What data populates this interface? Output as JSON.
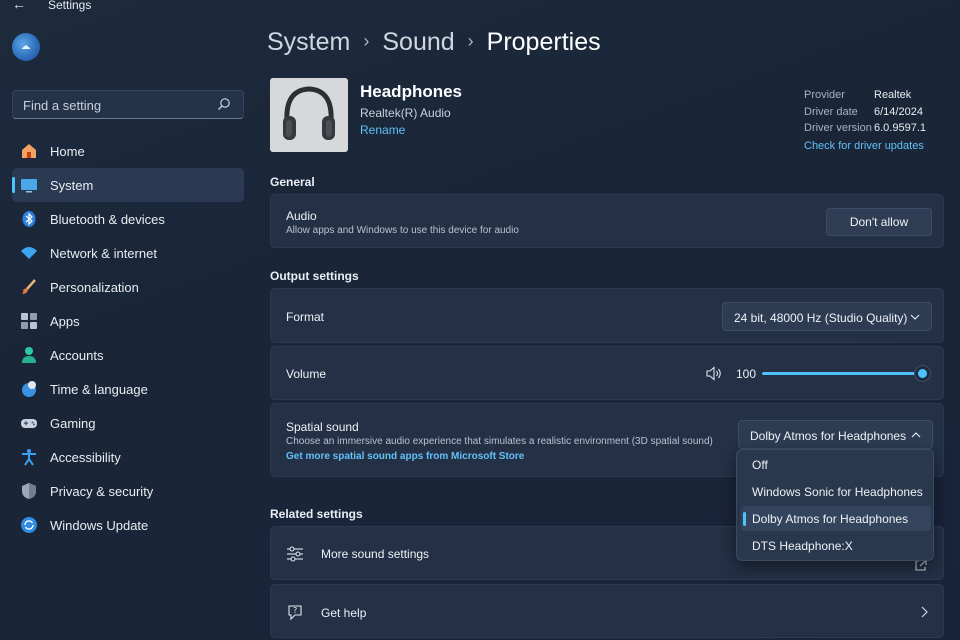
{
  "window": {
    "title": "Settings",
    "back_icon": "back-arrow-icon",
    "controls": [
      "minimize-icon",
      "maximize-icon",
      "close-icon"
    ]
  },
  "sidebar": {
    "search_placeholder": "Find a setting",
    "items": [
      {
        "label": "Home",
        "icon": "home-icon",
        "selected": false
      },
      {
        "label": "System",
        "icon": "system-icon",
        "selected": true
      },
      {
        "label": "Bluetooth & devices",
        "icon": "bluetooth-icon",
        "selected": false
      },
      {
        "label": "Network & internet",
        "icon": "wifi-icon",
        "selected": false
      },
      {
        "label": "Personalization",
        "icon": "brush-icon",
        "selected": false
      },
      {
        "label": "Apps",
        "icon": "apps-icon",
        "selected": false
      },
      {
        "label": "Accounts",
        "icon": "account-icon",
        "selected": false
      },
      {
        "label": "Time & language",
        "icon": "clock-globe-icon",
        "selected": false
      },
      {
        "label": "Gaming",
        "icon": "gamepad-icon",
        "selected": false
      },
      {
        "label": "Accessibility",
        "icon": "accessibility-icon",
        "selected": false
      },
      {
        "label": "Privacy & security",
        "icon": "shield-icon",
        "selected": false
      },
      {
        "label": "Windows Update",
        "icon": "update-icon",
        "selected": false
      }
    ]
  },
  "breadcrumb": [
    "System",
    "Sound",
    "Properties"
  ],
  "device": {
    "name": "Headphones",
    "driver_name": "Realtek(R) Audio",
    "rename_label": "Rename",
    "info": [
      {
        "key": "Provider",
        "value": "Realtek"
      },
      {
        "key": "Driver date",
        "value": "6/14/2024"
      },
      {
        "key": "Driver version",
        "value": "6.0.9597.1"
      }
    ],
    "driver_link": "Check for driver updates"
  },
  "general": {
    "title": "General",
    "audio": {
      "title": "Audio",
      "description": "Allow apps and Windows to use this device for audio",
      "button": "Don't allow"
    }
  },
  "output": {
    "title": "Output settings",
    "format": {
      "label": "Format",
      "value": "24 bit, 48000 Hz (Studio Quality)"
    },
    "volume": {
      "label": "Volume",
      "value": "100",
      "level": 1.0
    },
    "spatial": {
      "title": "Spatial sound",
      "description": "Choose an immersive audio experience that simulates a realistic environment (3D spatial sound)",
      "link": "Get more spatial sound apps from Microsoft Store",
      "selected": "Dolby Atmos for Headphones",
      "options": [
        "Off",
        "Windows Sonic for Headphones",
        "Dolby Atmos for Headphones",
        "DTS Headphone:X"
      ],
      "selected_index": 2
    }
  },
  "related": {
    "title": "Related settings",
    "more_sound": "More sound settings",
    "get_help": "Get help"
  },
  "colors": {
    "accent": "#4cc2ff",
    "link": "#62c0f5",
    "background": "#1c283b",
    "card": "#233046"
  }
}
